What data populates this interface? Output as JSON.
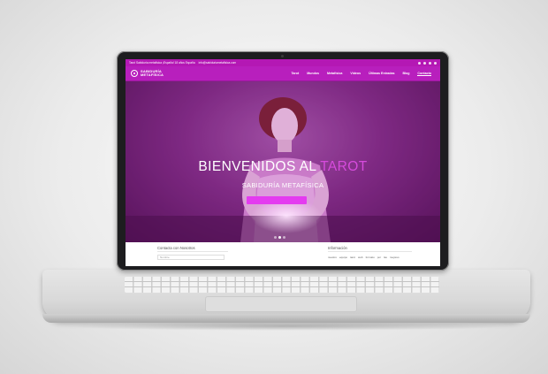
{
  "colors": {
    "brand": "#b81fbd",
    "accent": "#e43bf0",
    "title_accent": "#d64bdc"
  },
  "topbar": {
    "info_text": "Tarot Sabiduría metafísica ¡España! 18 años España",
    "email_text": "info@sabiduriametafisica.com",
    "social_icons": [
      "facebook-icon",
      "twitter-icon",
      "google-plus-icon",
      "instagram-icon"
    ]
  },
  "logo": {
    "line1": "SABIDURÍA",
    "line2": "METAFÍSICA"
  },
  "menu": {
    "items": [
      {
        "label": "Tarot"
      },
      {
        "label": "Mundos"
      },
      {
        "label": "Metafísica"
      },
      {
        "label": "Videos"
      },
      {
        "label": "Últimas Entradas"
      },
      {
        "label": "Blog"
      },
      {
        "label": "Contacto",
        "active": true
      }
    ]
  },
  "hero": {
    "title_main": "BIENVENIDOS AL ",
    "title_accent": "TAROT",
    "subtitle": "SABIDURÍA METAFÍSICA",
    "slider_dots": 3,
    "active_dot": 1
  },
  "contact": {
    "title": "Contacta con Nosotros",
    "input_placeholder": "Nombre"
  },
  "info": {
    "title": "Información",
    "tags": [
      "nuestro",
      "equipo",
      "tarot",
      "web",
      "formato",
      "por",
      "las",
      "mejores"
    ]
  }
}
